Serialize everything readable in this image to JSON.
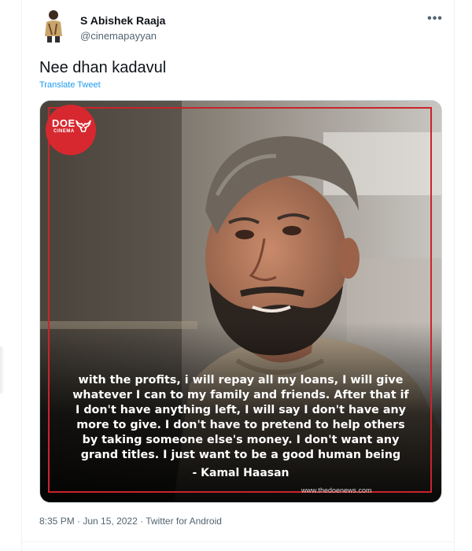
{
  "tweet": {
    "author": {
      "name": "S Abishek Raaja",
      "handle": "@cinemapayyan"
    },
    "more_label": "•••",
    "text": "Nee dhan kadavul",
    "translate_label": "Translate Tweet",
    "media": {
      "logo": {
        "text": "DOE",
        "sub": "CINEMA"
      },
      "quote_lines": [
        "with the profits, i will repay all my loans, I will give",
        "whatever I can to my family and friends. After that if",
        "I don't have anything left, I will say I don't have any",
        "more to give. I don't have to pretend to help others",
        "by taking someone else's money. I don't want any",
        "grand titles. I just want to be a good human being"
      ],
      "attribution": "- Kamal Haasan",
      "website": "www.thedoenews.com"
    },
    "time": "8:35 PM",
    "date": "Jun 15, 2022",
    "source": "Twitter for Android",
    "separator": " · "
  },
  "colors": {
    "link": "#1d9bf0",
    "frame": "#c9242b",
    "secondary_text": "#536471"
  }
}
